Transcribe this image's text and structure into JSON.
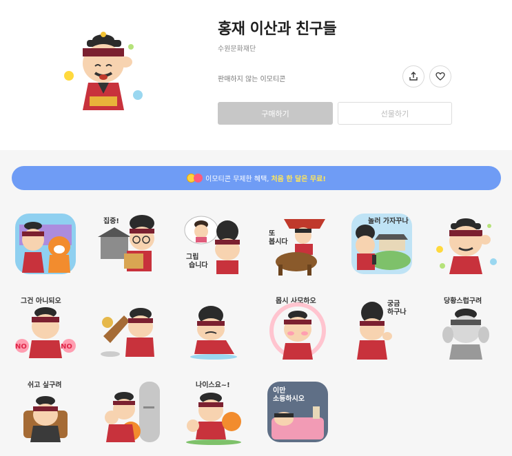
{
  "product": {
    "title": "홍재 이산과 친구들",
    "publisher": "수원문화재단",
    "notice": "판매하지 않는 이모티콘",
    "buy_label": "구매하기",
    "gift_label": "선물하기",
    "share_icon": "share-icon",
    "like_icon": "heart-icon"
  },
  "promo": {
    "text": "이모티콘 무제한 혜택,",
    "highlight": "처음 한 달은 무료!"
  },
  "captions": {
    "s2": "집중!",
    "s3": [
      "그립",
      "습니다"
    ],
    "s4": [
      "또",
      "봅시다"
    ],
    "s5": "놀러 가자꾸나",
    "s7": "그건 아니되오",
    "s7_no": "NO",
    "s10": "몹시 사모하오",
    "s11": [
      "궁금",
      "하구나"
    ],
    "s12": "당황스럽구려",
    "s13": "쉬고 싶구려",
    "s15": "나이스요~!",
    "s16": [
      "이만",
      "소등하시오"
    ]
  },
  "colors": {
    "promo_bg": "#6f9cf5",
    "promo_highlight": "#ffe65a",
    "buy_disabled": "#c7c7c7"
  }
}
